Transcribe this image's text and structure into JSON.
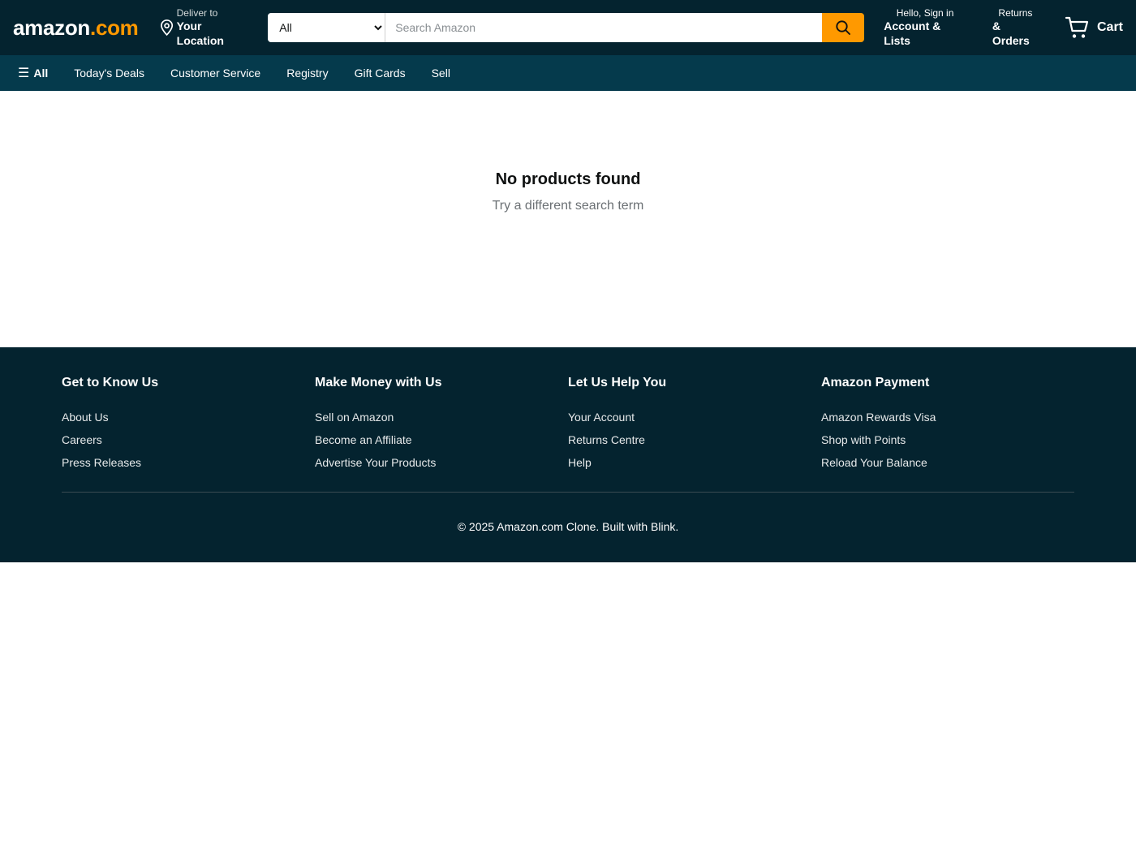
{
  "header": {
    "logo": {
      "word": "amazon",
      "suffix": ".com"
    },
    "deliver": {
      "line1": "Deliver to",
      "line2": "Your Location"
    },
    "search": {
      "category_selected": "All",
      "category_options": [
        "All"
      ],
      "value": "",
      "placeholder": "Search Amazon"
    },
    "account": {
      "line1": "Hello, Sign in",
      "line2": "Account & Lists"
    },
    "returns": {
      "line1": "Returns",
      "line2": "& Orders"
    },
    "cart": {
      "label": "Cart"
    }
  },
  "nav": {
    "all_label": "All",
    "links": [
      "Today's Deals",
      "Customer Service",
      "Registry",
      "Gift Cards",
      "Sell"
    ]
  },
  "main": {
    "title": "No products found",
    "subtitle": "Try a different search term"
  },
  "footer": {
    "columns": [
      {
        "title": "Get to Know Us",
        "links": [
          "About Us",
          "Careers",
          "Press Releases"
        ]
      },
      {
        "title": "Make Money with Us",
        "links": [
          "Sell on Amazon",
          "Become an Affiliate",
          "Advertise Your Products"
        ]
      },
      {
        "title": "Let Us Help You",
        "links": [
          "Your Account",
          "Returns Centre",
          "Help"
        ]
      },
      {
        "title": "Amazon Payment",
        "links": [
          "Amazon Rewards Visa",
          "Shop with Points",
          "Reload Your Balance"
        ]
      }
    ],
    "copyright": "© 2025 Amazon.com Clone. Built with Blink."
  },
  "colors": {
    "header_bg": "#04232f",
    "nav_bg": "#053a4c",
    "accent": "#ff9900"
  },
  "icons": {
    "location": "location-pin-icon",
    "search": "search-icon",
    "cart": "cart-icon",
    "menu": "hamburger-menu-icon"
  }
}
